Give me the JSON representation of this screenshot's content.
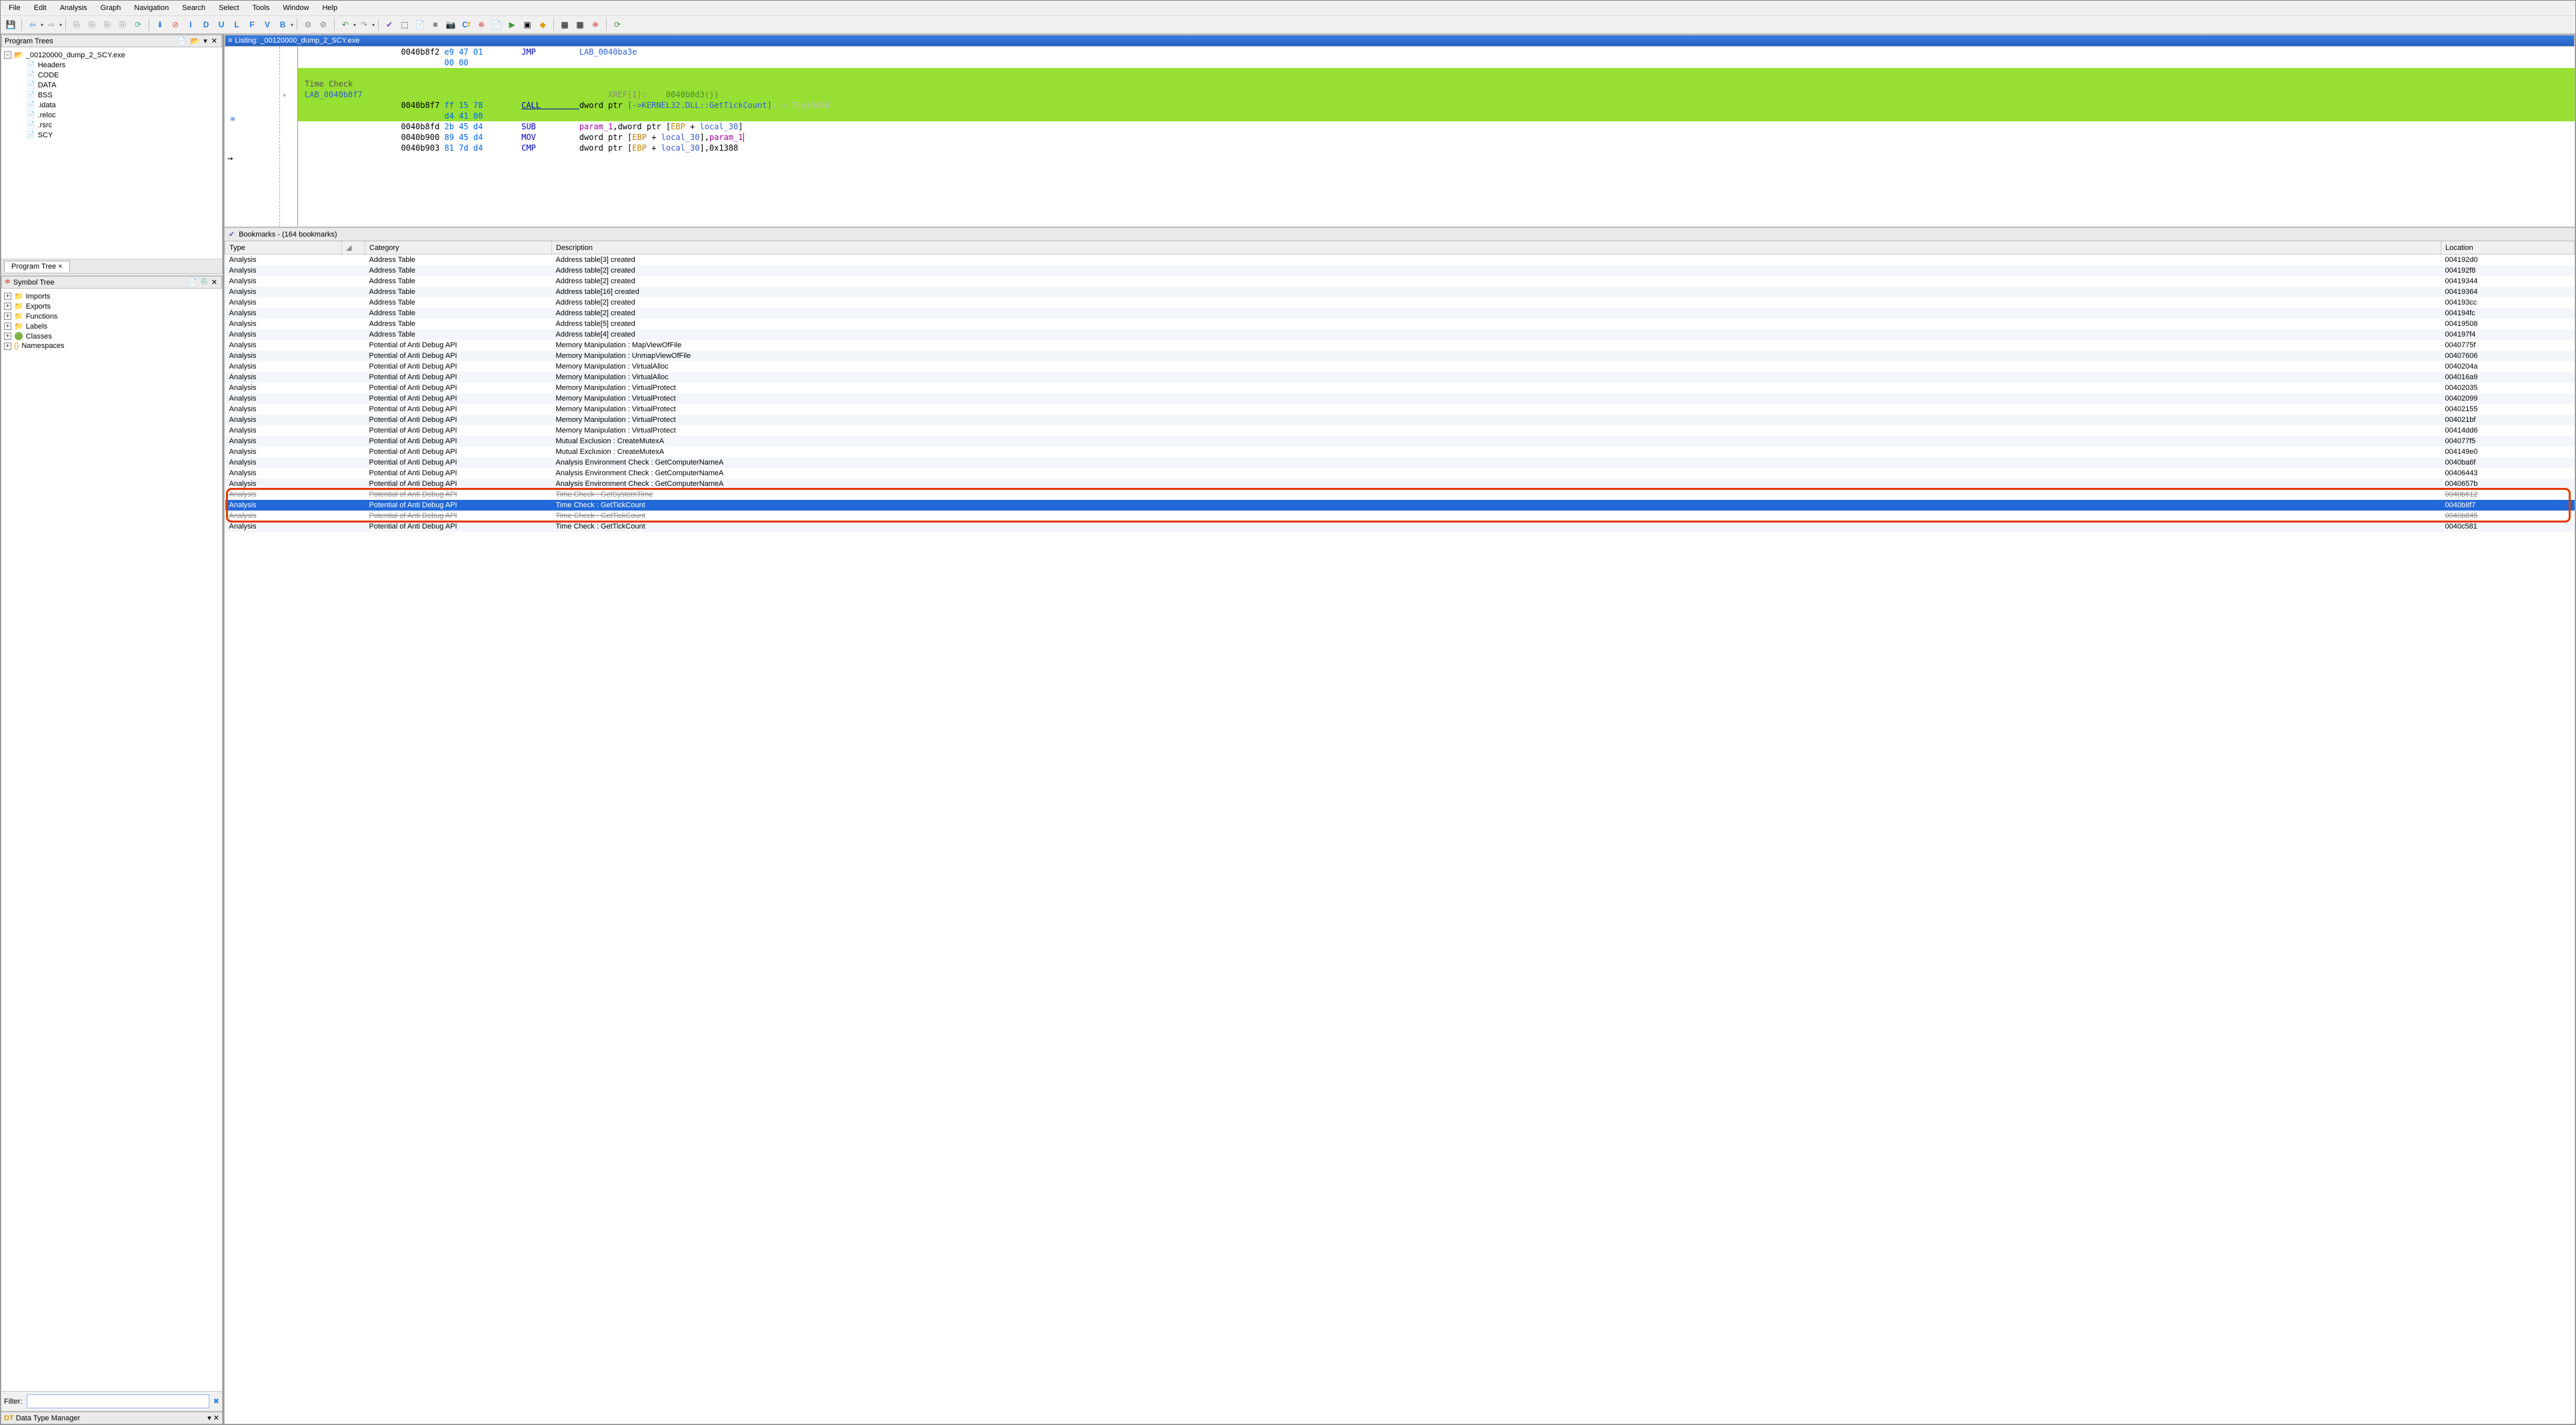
{
  "menu": [
    "File",
    "Edit",
    "Analysis",
    "Graph",
    "Navigation",
    "Search",
    "Select",
    "Tools",
    "Window",
    "Help"
  ],
  "program_trees": {
    "title": "Program Trees",
    "root": "_00120000_dump_2_SCY.exe",
    "children": [
      "Headers",
      "CODE",
      "DATA",
      "BSS",
      ".idata",
      ".reloc",
      ".rsrc",
      "SCY"
    ],
    "tab": "Program Tree"
  },
  "symbol_tree": {
    "title": "Symbol Tree",
    "items": [
      "Imports",
      "Exports",
      "Functions",
      "Labels",
      "Classes",
      "Namespaces"
    ]
  },
  "filter_label": "Filter:",
  "dtm_title": "Data Type Manager",
  "listing": {
    "title": "Listing:  _00120000_dump_2_SCY.exe",
    "lines": [
      {
        "addr": "0040b8f2",
        "bytes": "e9 47 01",
        "mn": "JMP",
        "op_label": "LAB_0040ba3e"
      },
      {
        "addr": "",
        "bytes": "00 00",
        "mn": "",
        "op_label": ""
      }
    ],
    "green_block": {
      "comment": "Time Check",
      "label": "LAB_0040b8f7",
      "xref_label": "XREF[1]:",
      "xref_val": "0040b8d3(j)",
      "addr": "0040b8f7",
      "bytes": "ff 15 78",
      "mn": "CALL",
      "op": "dword ptr [->KERNEL32.DLL::GetTickCount]",
      "dim": "; = 73e38c00",
      "bytes2": "d4 41 00"
    },
    "tail": [
      {
        "addr": "0040b8fd",
        "bytes": "2b 45 d4",
        "mn": "SUB",
        "ops": [
          {
            "t": "param",
            "v": "param_1"
          },
          {
            "t": "plain",
            "v": ",dword ptr ["
          },
          {
            "t": "reg",
            "v": "EBP"
          },
          {
            "t": "plain",
            "v": " + "
          },
          {
            "t": "local",
            "v": "local_30"
          },
          {
            "t": "plain",
            "v": "]"
          }
        ]
      },
      {
        "addr": "0040b900",
        "bytes": "89 45 d4",
        "mn": "MOV",
        "ops": [
          {
            "t": "plain",
            "v": "dword ptr ["
          },
          {
            "t": "reg",
            "v": "EBP"
          },
          {
            "t": "plain",
            "v": " + "
          },
          {
            "t": "local",
            "v": "local_30"
          },
          {
            "t": "plain",
            "v": "],"
          },
          {
            "t": "param",
            "v": "param_1"
          }
        ],
        "caret": true
      },
      {
        "addr": "0040b903",
        "bytes": "81 7d d4",
        "mn": "CMP",
        "ops": [
          {
            "t": "plain",
            "v": "dword ptr ["
          },
          {
            "t": "reg",
            "v": "EBP"
          },
          {
            "t": "plain",
            "v": " + "
          },
          {
            "t": "local",
            "v": "local_30"
          },
          {
            "t": "plain",
            "v": "],0x1388"
          }
        ]
      }
    ]
  },
  "bookmarks": {
    "title": "Bookmarks - (164 bookmarks)",
    "headers": [
      "Type",
      "",
      "Category",
      "Description",
      "Location"
    ],
    "rows": [
      {
        "type": "Analysis",
        "cat": "Address Table",
        "desc": "Address table[3] created",
        "loc": "004192d0"
      },
      {
        "type": "Analysis",
        "cat": "Address Table",
        "desc": "Address table[2] created",
        "loc": "004192f8"
      },
      {
        "type": "Analysis",
        "cat": "Address Table",
        "desc": "Address table[2] created",
        "loc": "00419344"
      },
      {
        "type": "Analysis",
        "cat": "Address Table",
        "desc": "Address table[16] created",
        "loc": "00419364"
      },
      {
        "type": "Analysis",
        "cat": "Address Table",
        "desc": "Address table[2] created",
        "loc": "004193cc"
      },
      {
        "type": "Analysis",
        "cat": "Address Table",
        "desc": "Address table[2] created",
        "loc": "004194fc"
      },
      {
        "type": "Analysis",
        "cat": "Address Table",
        "desc": "Address table[5] created",
        "loc": "00419508"
      },
      {
        "type": "Analysis",
        "cat": "Address Table",
        "desc": "Address table[4] created",
        "loc": "004197f4"
      },
      {
        "type": "Analysis",
        "cat": "Potential of Anti Debug API",
        "desc": "Memory Manipulation : MapViewOfFile",
        "loc": "0040775f"
      },
      {
        "type": "Analysis",
        "cat": "Potential of Anti Debug API",
        "desc": "Memory Manipulation : UnmapViewOfFile",
        "loc": "00407606"
      },
      {
        "type": "Analysis",
        "cat": "Potential of Anti Debug API",
        "desc": "Memory Manipulation : VirtualAlloc",
        "loc": "0040204a"
      },
      {
        "type": "Analysis",
        "cat": "Potential of Anti Debug API",
        "desc": "Memory Manipulation : VirtualAlloc",
        "loc": "004016a9"
      },
      {
        "type": "Analysis",
        "cat": "Potential of Anti Debug API",
        "desc": "Memory Manipulation : VirtualProtect",
        "loc": "00402035"
      },
      {
        "type": "Analysis",
        "cat": "Potential of Anti Debug API",
        "desc": "Memory Manipulation : VirtualProtect",
        "loc": "00402099"
      },
      {
        "type": "Analysis",
        "cat": "Potential of Anti Debug API",
        "desc": "Memory Manipulation : VirtualProtect",
        "loc": "00402155"
      },
      {
        "type": "Analysis",
        "cat": "Potential of Anti Debug API",
        "desc": "Memory Manipulation : VirtualProtect",
        "loc": "004021bf"
      },
      {
        "type": "Analysis",
        "cat": "Potential of Anti Debug API",
        "desc": "Memory Manipulation : VirtualProtect",
        "loc": "00414dd6"
      },
      {
        "type": "Analysis",
        "cat": "Potential of Anti Debug API",
        "desc": "Mutual Exclusion : CreateMutexA",
        "loc": "004077f5"
      },
      {
        "type": "Analysis",
        "cat": "Potential of Anti Debug API",
        "desc": "Mutual Exclusion : CreateMutexA",
        "loc": "004149e0"
      },
      {
        "type": "Analysis",
        "cat": "Potential of Anti Debug API",
        "desc": "Analysis Environment Check : GetComputerNameA",
        "loc": "0040ba6f"
      },
      {
        "type": "Analysis",
        "cat": "Potential of Anti Debug API",
        "desc": "Analysis Environment Check : GetComputerNameA",
        "loc": "00406443"
      },
      {
        "type": "Analysis",
        "cat": "Potential of Anti Debug API",
        "desc": "Analysis Environment Check : GetComputerNameA",
        "loc": "0040657b"
      },
      {
        "type": "Analysis",
        "cat": "Potential of Anti Debug API",
        "desc": "Time Check : GetSystemTime",
        "loc": "0040b612",
        "strike": true
      },
      {
        "type": "Analysis",
        "cat": "Potential of Anti Debug API",
        "desc": "Time Check : GetTickCount",
        "loc": "0040b8f7",
        "selected": true
      },
      {
        "type": "Analysis",
        "cat": "Potential of Anti Debug API",
        "desc": "Time Check : GetTickCount",
        "loc": "0040b845",
        "strike": true
      },
      {
        "type": "Analysis",
        "cat": "Potential of Anti Debug API",
        "desc": "Time Check : GetTickCount",
        "loc": "0040c581"
      }
    ]
  }
}
